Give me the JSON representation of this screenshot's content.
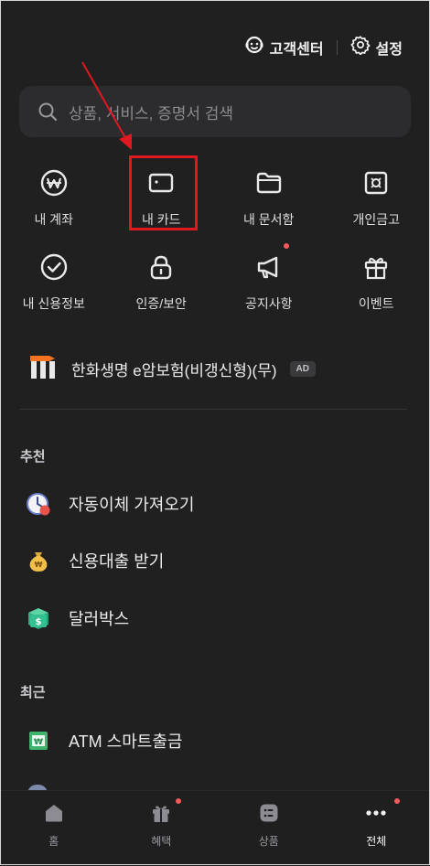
{
  "header": {
    "support_label": "고객센터",
    "settings_label": "설정"
  },
  "search": {
    "placeholder": "상품, 서비스, 증명서 검색"
  },
  "menu": {
    "row1": [
      {
        "label": "내 계좌",
        "icon": "won-circle-icon"
      },
      {
        "label": "내 카드",
        "icon": "card-icon",
        "highlighted": true
      },
      {
        "label": "내 문서함",
        "icon": "folder-icon"
      },
      {
        "label": "개인금고",
        "icon": "safe-icon"
      }
    ],
    "row2": [
      {
        "label": "내 신용정보",
        "icon": "check-circle-icon"
      },
      {
        "label": "인증/보안",
        "icon": "lock-icon"
      },
      {
        "label": "공지사항",
        "icon": "megaphone-icon",
        "new": true
      },
      {
        "label": "이벤트",
        "icon": "gift-icon"
      }
    ]
  },
  "ad": {
    "text": "한화생명 e암보험(비갱신형)(무)",
    "badge": "AD"
  },
  "recommended": {
    "title": "추천",
    "items": [
      {
        "label": "자동이체 가져오기",
        "icon": "clock-transfer-icon"
      },
      {
        "label": "신용대출 받기",
        "icon": "money-bag-icon"
      },
      {
        "label": "달러박스",
        "icon": "dollar-box-icon"
      }
    ]
  },
  "recent": {
    "title": "최근",
    "items": [
      {
        "label": "ATM 스마트출금",
        "icon": "atm-cash-icon"
      }
    ]
  },
  "bottom_nav": [
    {
      "label": "홈",
      "icon": "home-icon",
      "active": false
    },
    {
      "label": "혜택",
      "icon": "gift-tab-icon",
      "active": false,
      "new": true
    },
    {
      "label": "상품",
      "icon": "product-list-icon",
      "active": false
    },
    {
      "label": "전체",
      "icon": "more-dots-icon",
      "active": true,
      "new": true
    }
  ],
  "colors": {
    "background": "#202021",
    "highlight": "#e0181f",
    "badge_dot": "#f45a5a",
    "annotation_arrow": "#e0181f"
  }
}
